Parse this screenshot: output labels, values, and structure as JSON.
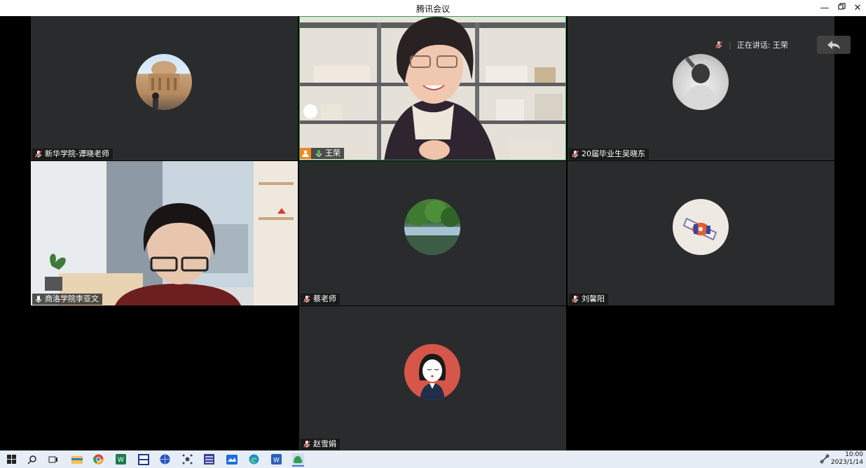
{
  "window": {
    "title": "腾讯会议"
  },
  "speaking": {
    "text": "正在讲话: 王荣"
  },
  "tiles": [
    {
      "name": "新华学院-谭晓老师",
      "mic": "muted",
      "kind": "avatar",
      "avatar": "building-photo"
    },
    {
      "name": "王荣",
      "mic": "active",
      "kind": "video",
      "host": true
    },
    {
      "name": "20届毕业生吴晓东",
      "mic": "muted",
      "kind": "avatar",
      "avatar": "person-bw-photo"
    },
    {
      "name": "商洛学院李亚文",
      "mic": "on",
      "kind": "video"
    },
    {
      "name": "蔡老师",
      "mic": "muted",
      "kind": "avatar",
      "avatar": "lake-photo"
    },
    {
      "name": "刘馨阳",
      "mic": "muted",
      "kind": "avatar",
      "avatar": "candy-photo"
    },
    {
      "name": "赵雪娟",
      "mic": "muted",
      "kind": "avatar",
      "avatar": "cartoon-girl"
    }
  ],
  "taskbar": {
    "icons": [
      "windows-start-icon",
      "search-icon",
      "task-view-icon",
      "file-explorer-icon",
      "chrome-icon",
      "wps-icon",
      "isp-icon",
      "globe-icon",
      "network-icon",
      "app-icon",
      "mail-icon",
      "edge-icon",
      "word-icon",
      "tencent-meeting-icon"
    ],
    "time": "10:00",
    "date": "2023/1/14"
  },
  "colors": {
    "active_border": "#2fa04e",
    "mic_muted": "#e0443e",
    "host_badge": "#f08a24"
  }
}
